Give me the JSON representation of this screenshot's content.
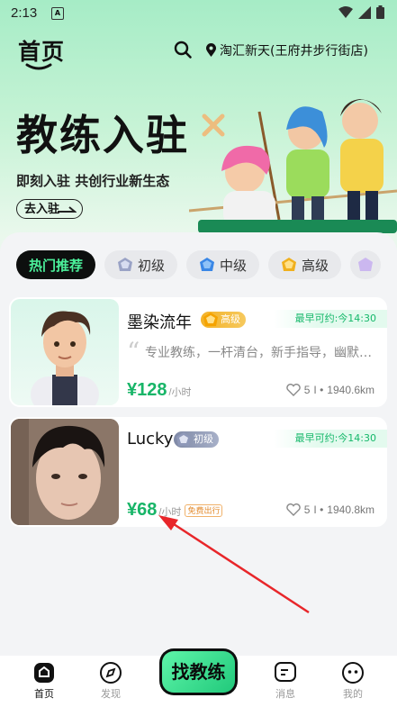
{
  "status_bar": {
    "time": "2:13",
    "app_icon_letter": "A"
  },
  "header": {
    "title": "首页",
    "location": "淘汇新天(王府井步行街店)"
  },
  "banner": {
    "title": "教练入驻",
    "subtitle": "即刻入驻 共创行业新生态",
    "button_label": "去入驻"
  },
  "tabs": [
    {
      "label": "热门推荐",
      "active": true
    },
    {
      "label": "初级",
      "active": false
    },
    {
      "label": "中级",
      "active": false
    },
    {
      "label": "高级",
      "active": false
    }
  ],
  "coaches": [
    {
      "name": "墨染流年",
      "level": "高级",
      "availability": "最早可约:今14:30",
      "intro": "专业教练，一杆清台，新手指导，幽默风趣",
      "price": "¥128",
      "unit": "/小时",
      "free_tag": "",
      "likes": "5",
      "distance": "1940.6km"
    },
    {
      "name": "Lucky",
      "level": "初级",
      "availability": "最早可约:今14:30",
      "intro": "",
      "price": "¥68",
      "unit": "/小时",
      "free_tag": "免费出行",
      "likes": "5",
      "distance": "1940.8km"
    }
  ],
  "bottom_nav": {
    "items": [
      {
        "label": "首页",
        "icon": "home-icon",
        "active": true
      },
      {
        "label": "发现",
        "icon": "compass-icon",
        "active": false
      },
      {
        "label": "消息",
        "icon": "message-icon",
        "active": false
      },
      {
        "label": "我的",
        "icon": "profile-icon",
        "active": false
      }
    ],
    "center_button": "找教练"
  },
  "colors": {
    "accent": "#18b568",
    "active_tab_text": "#4bf09a",
    "dark": "#0d0f0e"
  }
}
